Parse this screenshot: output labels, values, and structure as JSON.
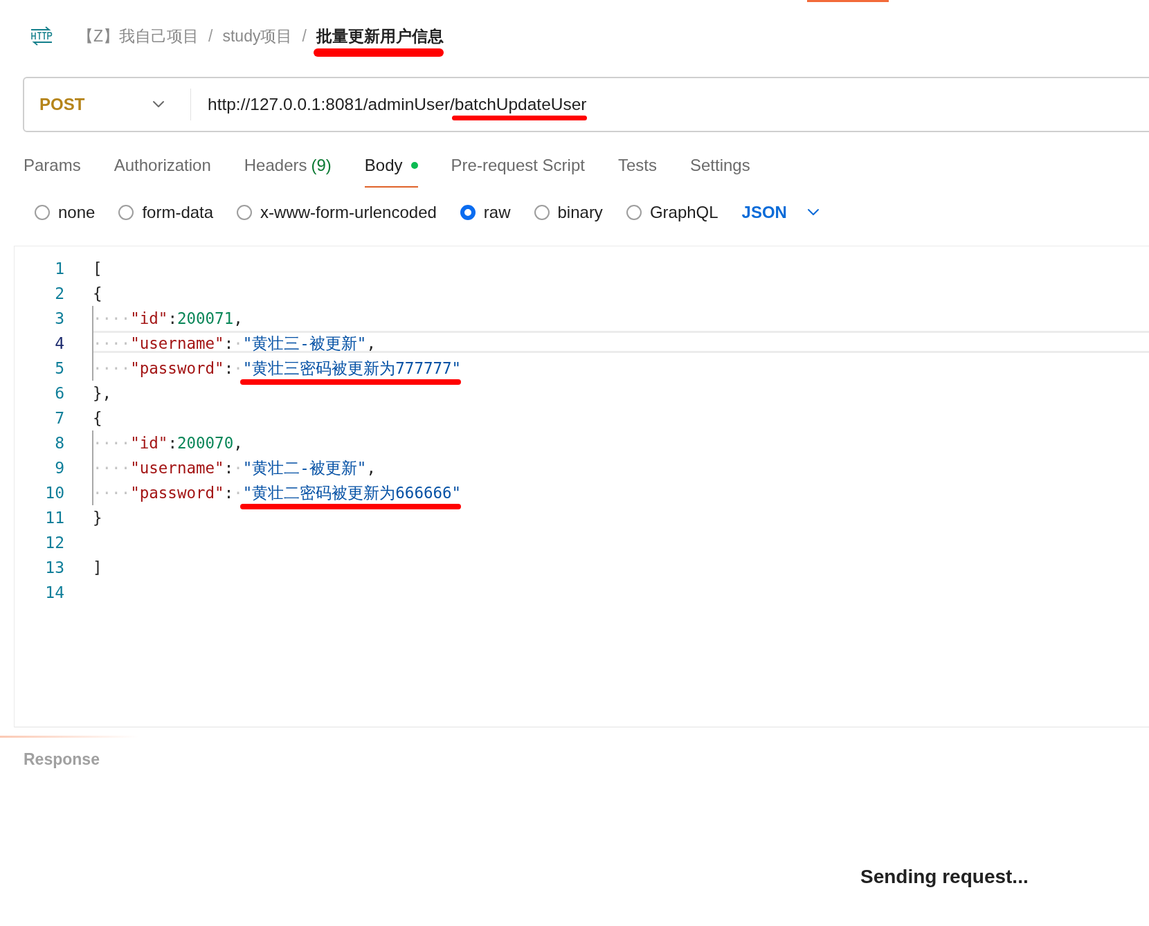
{
  "breadcrumb": [
    {
      "text": "【Z】我自己项目",
      "current": false,
      "marked": false
    },
    {
      "text": "study项目",
      "current": false,
      "marked": false
    },
    {
      "text": "批量更新用户信息",
      "current": true,
      "marked": true
    }
  ],
  "separator": "/",
  "request": {
    "method": "POST",
    "url_parts": [
      {
        "text": "http://127.0.0.1:8081/adminUser/",
        "marked": false
      },
      {
        "text": "batchUpdateUser",
        "marked": true
      }
    ]
  },
  "tabs": [
    {
      "label": "Params",
      "selected": false,
      "dot": false
    },
    {
      "label": "Authorization",
      "selected": false,
      "dot": false
    },
    {
      "label": "Headers",
      "count": "(9)",
      "selected": false,
      "dot": false
    },
    {
      "label": "Body",
      "selected": true,
      "dot": true
    },
    {
      "label": "Pre-request Script",
      "selected": false,
      "dot": false
    },
    {
      "label": "Tests",
      "selected": false,
      "dot": false
    },
    {
      "label": "Settings",
      "selected": false,
      "dot": false
    }
  ],
  "body_types": [
    {
      "label": "none",
      "selected": false
    },
    {
      "label": "form-data",
      "selected": false
    },
    {
      "label": "x-www-form-urlencoded",
      "selected": false
    },
    {
      "label": "raw",
      "selected": true
    },
    {
      "label": "binary",
      "selected": false
    },
    {
      "label": "GraphQL",
      "selected": false
    }
  ],
  "format": "JSON",
  "editor": {
    "lines": [
      {
        "number": "1",
        "active": false,
        "guide": false,
        "tokens": [
          {
            "kind": "punct",
            "text": "["
          }
        ]
      },
      {
        "number": "2",
        "active": false,
        "guide": false,
        "tokens": [
          {
            "kind": "punct",
            "text": "{"
          }
        ]
      },
      {
        "number": "3",
        "active": false,
        "guide": true,
        "tokens": [
          {
            "kind": "ws",
            "text": "····"
          },
          {
            "kind": "key",
            "text": "\"id\""
          },
          {
            "kind": "punct",
            "text": ":"
          },
          {
            "kind": "number",
            "text": "200071"
          },
          {
            "kind": "punct",
            "text": ","
          }
        ]
      },
      {
        "number": "4",
        "active": true,
        "guide": true,
        "tokens": [
          {
            "kind": "ws",
            "text": "····"
          },
          {
            "kind": "key",
            "text": "\"username\""
          },
          {
            "kind": "punct",
            "text": ":"
          },
          {
            "kind": "ws",
            "text": "·"
          },
          {
            "kind": "string",
            "text": "\"黄壮三-被更新\"",
            "marked": false
          },
          {
            "kind": "punct",
            "text": ","
          }
        ]
      },
      {
        "number": "5",
        "active": false,
        "guide": true,
        "tokens": [
          {
            "kind": "ws",
            "text": "····"
          },
          {
            "kind": "key",
            "text": "\"password\""
          },
          {
            "kind": "punct",
            "text": ":"
          },
          {
            "kind": "ws",
            "text": "·"
          },
          {
            "kind": "string",
            "text": "\"黄壮三密码被更新为777777\"",
            "marked": true
          }
        ]
      },
      {
        "number": "6",
        "active": false,
        "guide": false,
        "tokens": [
          {
            "kind": "punct",
            "text": "},"
          }
        ]
      },
      {
        "number": "7",
        "active": false,
        "guide": false,
        "tokens": [
          {
            "kind": "punct",
            "text": "{"
          }
        ]
      },
      {
        "number": "8",
        "active": false,
        "guide": true,
        "tokens": [
          {
            "kind": "ws",
            "text": "····"
          },
          {
            "kind": "key",
            "text": "\"id\""
          },
          {
            "kind": "punct",
            "text": ":"
          },
          {
            "kind": "number",
            "text": "200070"
          },
          {
            "kind": "punct",
            "text": ","
          }
        ]
      },
      {
        "number": "9",
        "active": false,
        "guide": true,
        "tokens": [
          {
            "kind": "ws",
            "text": "····"
          },
          {
            "kind": "key",
            "text": "\"username\""
          },
          {
            "kind": "punct",
            "text": ":"
          },
          {
            "kind": "ws",
            "text": "·"
          },
          {
            "kind": "string",
            "text": "\"黄壮二-被更新\"",
            "marked": false
          },
          {
            "kind": "punct",
            "text": ","
          }
        ]
      },
      {
        "number": "10",
        "active": false,
        "guide": true,
        "tokens": [
          {
            "kind": "ws",
            "text": "····"
          },
          {
            "kind": "key",
            "text": "\"password\""
          },
          {
            "kind": "punct",
            "text": ":"
          },
          {
            "kind": "ws",
            "text": "·"
          },
          {
            "kind": "string",
            "text": "\"黄壮二密码被更新为666666\"",
            "marked": true
          }
        ]
      },
      {
        "number": "11",
        "active": false,
        "guide": false,
        "tokens": [
          {
            "kind": "punct",
            "text": "}"
          }
        ]
      },
      {
        "number": "12",
        "active": false,
        "guide": false
      },
      {
        "number": "13",
        "active": false,
        "guide": false,
        "tokens": [
          {
            "kind": "punct",
            "text": "]"
          }
        ]
      },
      {
        "number": "14",
        "active": false,
        "guide": false
      }
    ]
  },
  "response": {
    "title": "Response",
    "status": "Sending request..."
  }
}
